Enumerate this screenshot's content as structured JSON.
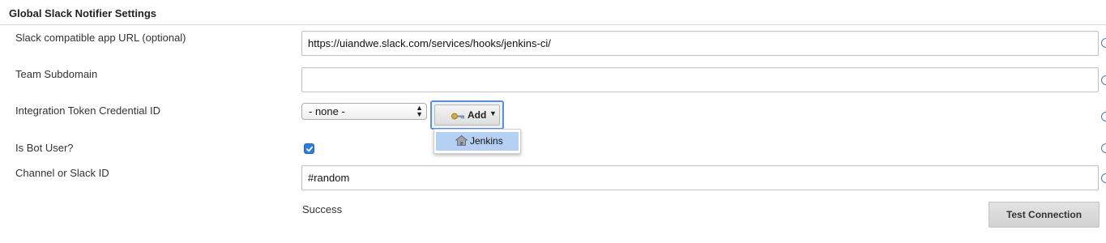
{
  "section": {
    "title": "Global Slack Notifier Settings"
  },
  "fields": {
    "app_url": {
      "label": "Slack compatible app URL (optional)",
      "value": "https://uiandwe.slack.com/services/hooks/jenkins-ci/"
    },
    "team_subdomain": {
      "label": "Team Subdomain",
      "value": ""
    },
    "credential": {
      "label": "Integration Token Credential ID",
      "selected": "- none -",
      "add_label": "Add",
      "menu_items": [
        "Jenkins"
      ]
    },
    "bot_user": {
      "label": "Is Bot User?",
      "checked": true
    },
    "channel": {
      "label": "Channel or Slack ID",
      "value": "#random"
    }
  },
  "status": {
    "text": "Success"
  },
  "test_button": {
    "label": "Test Connection"
  },
  "colors": {
    "accent": "#2f7de1",
    "menu_highlight": "#b6d0f4",
    "help_icon": "#4a78b5"
  },
  "icons": {
    "add": "key-icon",
    "menu": "jenkins-icon",
    "help": "help-icon"
  }
}
